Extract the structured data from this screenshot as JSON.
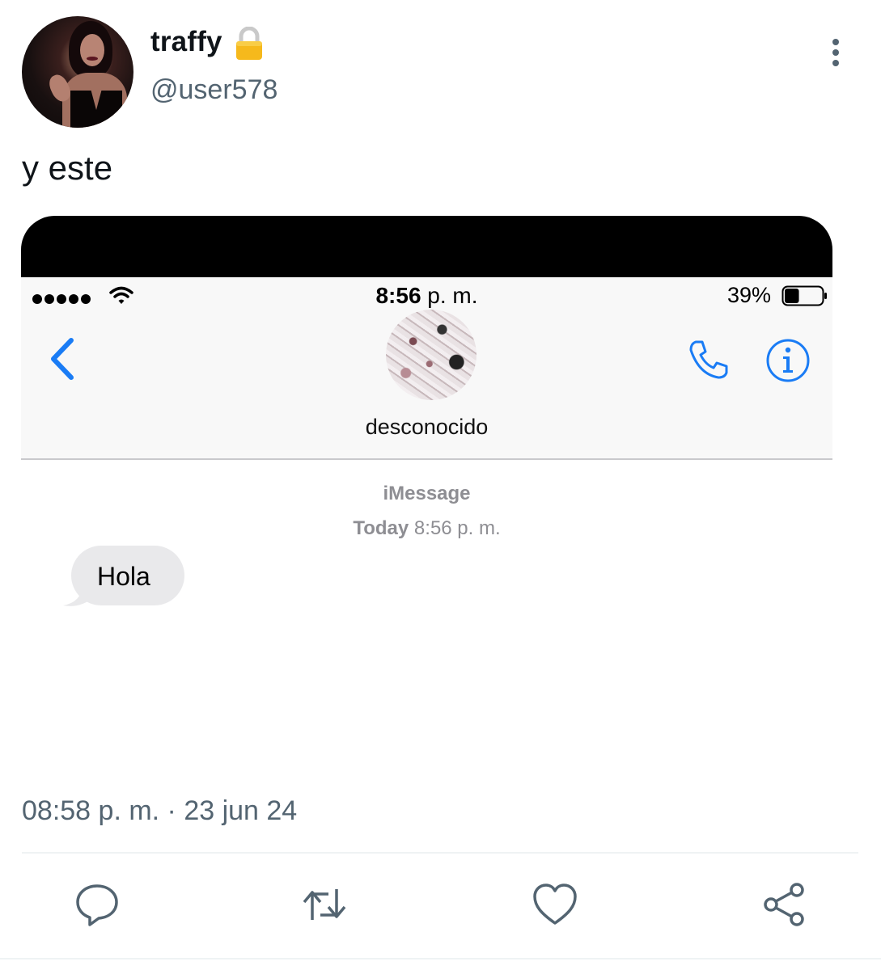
{
  "tweet": {
    "display_name": "traffy",
    "handle": "@user578",
    "text": "y este",
    "date_time": "08:58 p. m. · 23 jun 24",
    "protected_icon": "lock-icon"
  },
  "screenshot": {
    "status_bar": {
      "time": "8:56",
      "time_suffix": "p. m.",
      "battery_percent": "39%",
      "battery_level": 0.39
    },
    "contact_name": "desconocido",
    "service_label": "iMessage",
    "timestamp_day": "Today",
    "timestamp_time": "8:56 p. m.",
    "messages": [
      {
        "text": "Hola",
        "direction": "incoming"
      }
    ]
  },
  "actions": [
    "reply-icon",
    "retweet-icon",
    "like-icon",
    "share-icon"
  ],
  "colors": {
    "text": "#0f1419",
    "secondary": "#536471",
    "ios_blue": "#1a7cf5",
    "ios_gray": "#8e8e93",
    "bubble_gray": "#e9e9eb"
  }
}
